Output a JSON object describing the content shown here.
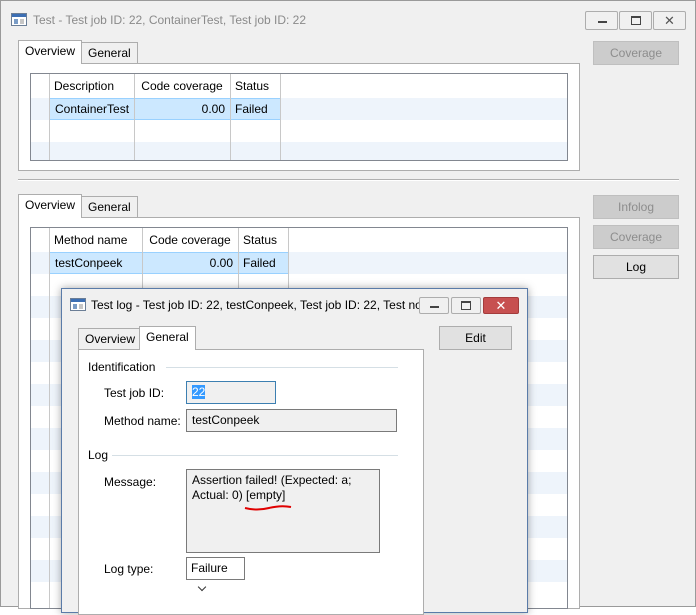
{
  "main_window": {
    "title": "Test - Test job ID: 22, ContainerTest, Test job ID: 22"
  },
  "top_section": {
    "tabs": [
      {
        "label": "Overview",
        "active": true
      },
      {
        "label": "General",
        "active": false
      }
    ],
    "grid": {
      "columns": [
        "Description",
        "Code coverage",
        "Status"
      ],
      "rows": [
        {
          "description": "ContainerTest",
          "code_coverage": "0.00",
          "status": "Failed",
          "selected": true
        }
      ]
    },
    "buttons": {
      "coverage": {
        "label": "Coverage",
        "enabled": false
      }
    }
  },
  "bottom_section": {
    "tabs": [
      {
        "label": "Overview",
        "active": true
      },
      {
        "label": "General",
        "active": false
      }
    ],
    "grid": {
      "columns": [
        "Method name",
        "Code coverage",
        "Status"
      ],
      "rows": [
        {
          "method_name": "testConpeek",
          "code_coverage": "0.00",
          "status": "Failed",
          "selected": true
        }
      ]
    },
    "buttons": {
      "infolog": {
        "label": "Infolog",
        "enabled": false
      },
      "coverage": {
        "label": "Coverage",
        "enabled": false
      },
      "log": {
        "label": "Log",
        "enabled": true
      }
    }
  },
  "dialog": {
    "title": "Test log - Test job ID: 22, testConpeek, Test job ID: 22, Test no...",
    "tabs": [
      {
        "label": "Overview",
        "active": false
      },
      {
        "label": "General",
        "active": true
      }
    ],
    "edit_button": "Edit",
    "identification": {
      "heading": "Identification",
      "test_job_id_label": "Test job ID:",
      "test_job_id_value": "22",
      "method_name_label": "Method name:",
      "method_name_value": "testConpeek"
    },
    "log": {
      "heading": "Log",
      "message_label": "Message:",
      "message_line1": "Assertion failed! (Expected: a;",
      "message_line2": "Actual: 0) [empty]",
      "log_type_label": "Log type:",
      "log_type_value": "Failure"
    }
  },
  "colors": {
    "selection": "#cce8ff",
    "selected_text": "#3399ff",
    "annotation": "#e00000",
    "close_button": "#c75050"
  }
}
